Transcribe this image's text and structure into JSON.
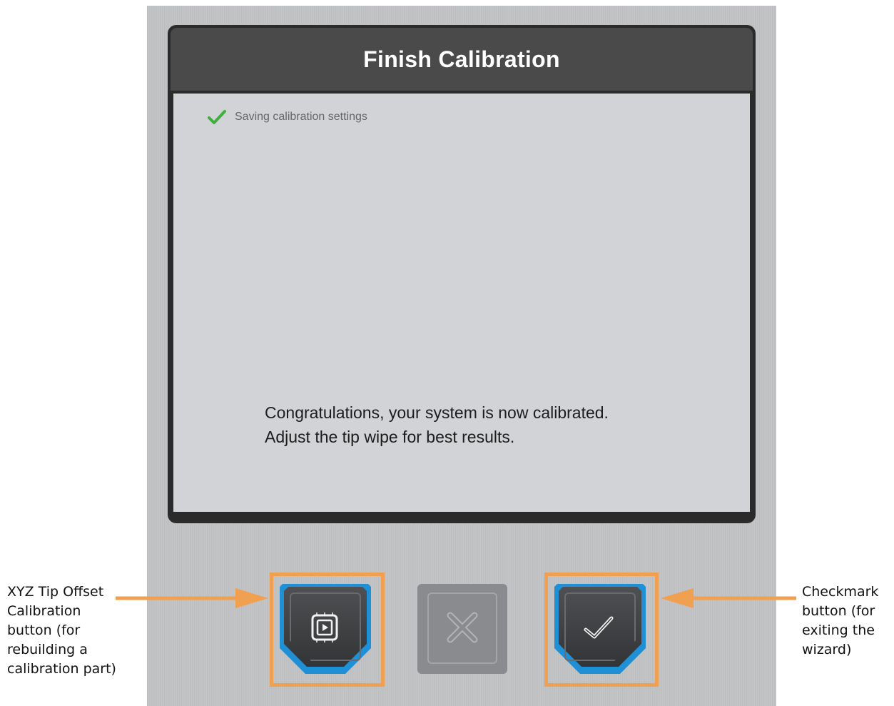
{
  "dialog": {
    "title": "Finish Calibration",
    "status_text": "Saving calibration settings",
    "message_line1": "Congratulations, your system is now calibrated.",
    "message_line2": "Adjust the tip wipe for best results."
  },
  "buttons": {
    "left_icon": "calibration-part-icon",
    "middle_icon": "close-icon",
    "right_icon": "checkmark-icon"
  },
  "callouts": {
    "left_lines": [
      "XYZ Tip Offset",
      "Calibration",
      "button (for",
      "rebuilding a",
      "calibration part)"
    ],
    "right_lines": [
      "Checkmark",
      "button (for",
      "exiting the",
      "wizard)"
    ]
  },
  "colors": {
    "highlight": "#f0a050",
    "accent_blue": "#1f8fd6",
    "check_green": "#3fae3f"
  }
}
